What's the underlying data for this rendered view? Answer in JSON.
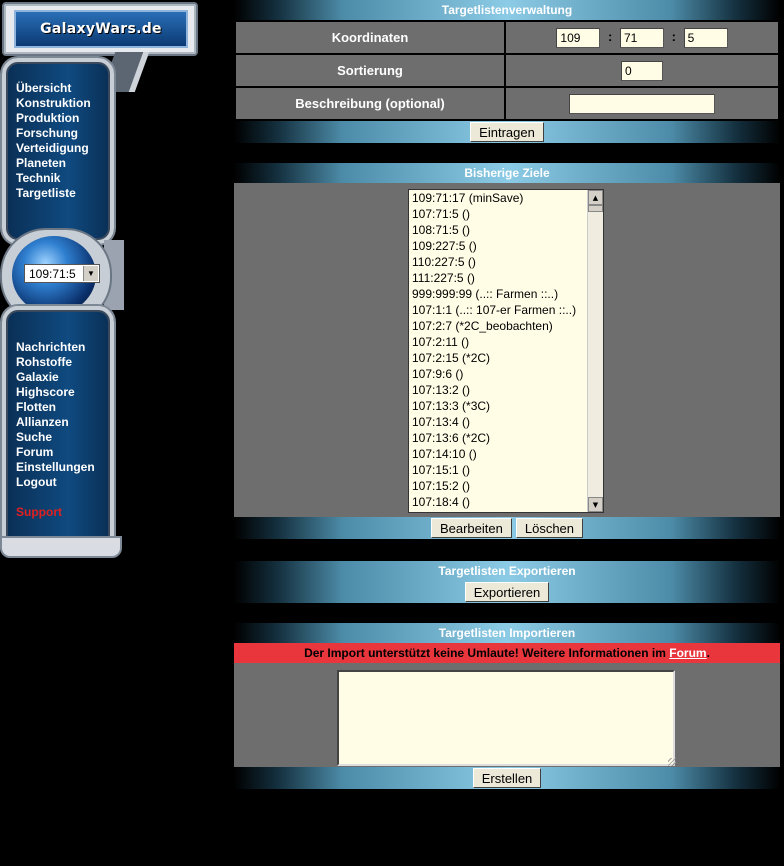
{
  "sidebar": {
    "logo": "GalaxyWars.de",
    "nav_top": [
      "Übersicht",
      "Konstruktion",
      "Produktion",
      "Forschung",
      "Verteidigung",
      "Planeten",
      "Technik",
      "Targetliste"
    ],
    "planet_select": "109:71:5",
    "nav_bottom": [
      "Nachrichten",
      "Rohstoffe",
      "Galaxie",
      "Highscore",
      "Flotten",
      "Allianzen",
      "Suche",
      "Forum",
      "Einstellungen",
      "Logout"
    ],
    "support": "Support",
    "icons": {
      "planet": "globe-icon",
      "dropdown": "chevron-down-icon"
    }
  },
  "verwaltung": {
    "header": "Targetlistenverwaltung",
    "label_koordinaten": "Koordinaten",
    "coord_1": "109",
    "coord_2": "71",
    "coord_3": "5",
    "colon": ":",
    "label_sortierung": "Sortierung",
    "sortierung": "0",
    "label_beschreibung": "Beschreibung (optional)",
    "beschreibung": "",
    "button_eintragen": "Eintragen"
  },
  "ziele": {
    "header": "Bisherige Ziele",
    "items": [
      "109:71:17 (minSave)",
      "107:71:5 ()",
      "108:71:5 ()",
      "109:227:5 ()",
      "110:227:5 ()",
      "111:227:5 ()",
      "999:999:99 (..:: Farmen ::..)",
      "107:1:1 (..:: 107-er Farmen ::..)",
      "107:2:7 (*2C_beobachten)",
      "107:2:11 ()",
      "107:2:15 (*2C)",
      "107:9:6 ()",
      "107:13:2 ()",
      "107:13:3 (*3C)",
      "107:13:4 ()",
      "107:13:6 (*2C)",
      "107:14:10 ()",
      "107:15:1 ()",
      "107:15:2 ()",
      "107:18:4 ()"
    ],
    "button_bearbeiten": "Bearbeiten",
    "button_loeschen": "Löschen"
  },
  "exportieren": {
    "header": "Targetlisten Exportieren",
    "button": "Exportieren"
  },
  "importieren": {
    "header": "Targetlisten Importieren",
    "warning": "Der Import unterstützt keine Umlaute! Weitere Informationen im ",
    "warning_link": "Forum",
    "warning_end": ".",
    "textarea_value": "",
    "button": "Erstellen"
  },
  "colors": {
    "background": "#000000",
    "panel_gray": "#6e6e6e",
    "input_bg": "#fffde6",
    "warning_red": "#e8363c",
    "support_red": "#e02020",
    "header_cyan": "#8ccbe6"
  }
}
